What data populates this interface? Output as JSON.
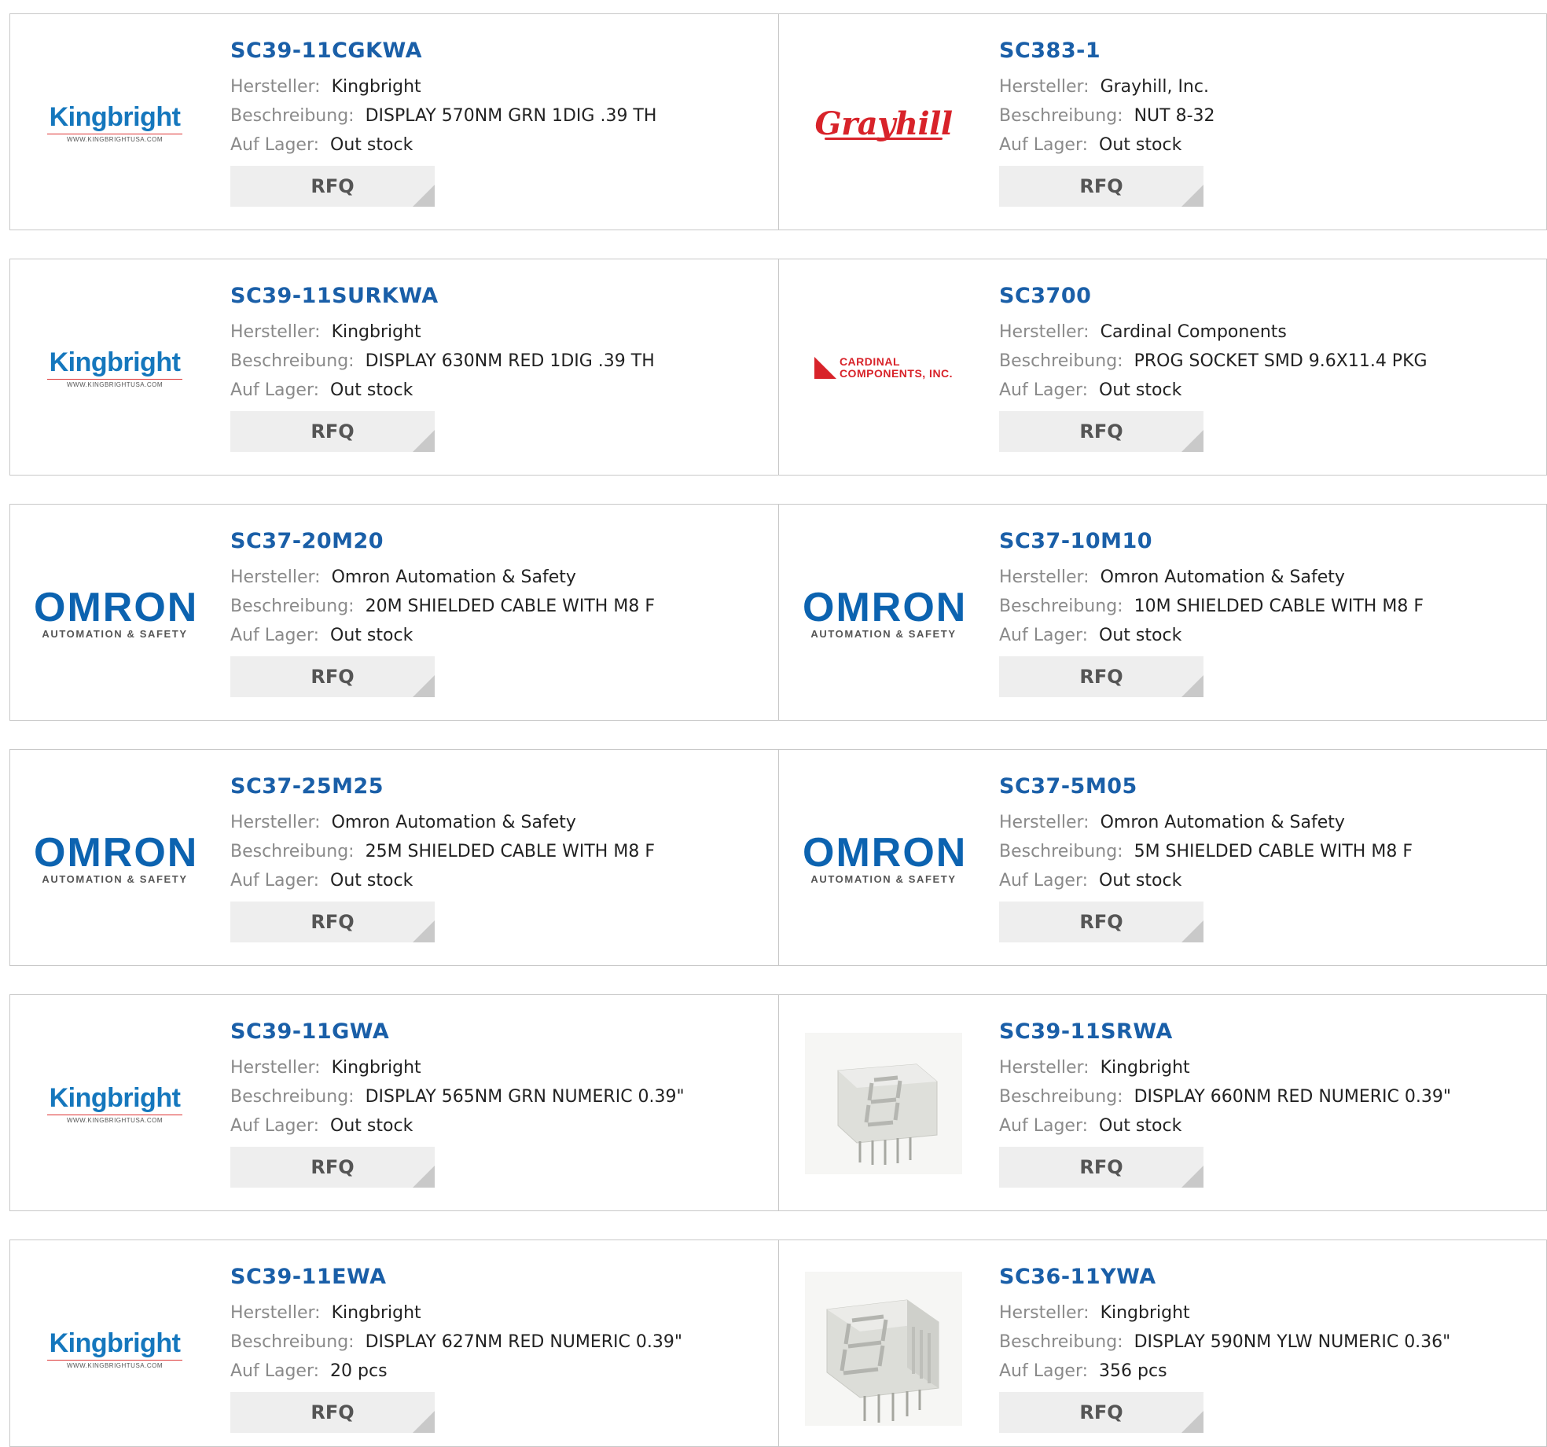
{
  "labels": {
    "manufacturer": "Hersteller:",
    "description": "Beschreibung:",
    "stock": "Auf Lager:",
    "rfq": "RFQ"
  },
  "rows": [
    [
      {
        "part": "SC39-11CGKWA",
        "manufacturer": "Kingbright",
        "description": "DISPLAY 570NM GRN 1DIG .39 TH",
        "stock": "Out stock",
        "logo": "kingbright"
      },
      {
        "part": "SC383-1",
        "manufacturer": "Grayhill, Inc.",
        "description": "NUT 8-32",
        "stock": "Out stock",
        "logo": "grayhill"
      }
    ],
    [
      {
        "part": "SC39-11SURKWA",
        "manufacturer": "Kingbright",
        "description": "DISPLAY 630NM RED 1DIG .39 TH",
        "stock": "Out stock",
        "logo": "kingbright"
      },
      {
        "part": "SC3700",
        "manufacturer": "Cardinal Components",
        "description": "PROG SOCKET SMD 9.6X11.4 PKG",
        "stock": "Out stock",
        "logo": "cardinal"
      }
    ],
    [
      {
        "part": "SC37-20M20",
        "manufacturer": "Omron Automation & Safety",
        "description": "20M SHIELDED CABLE WITH M8 F",
        "stock": "Out stock",
        "logo": "omron"
      },
      {
        "part": "SC37-10M10",
        "manufacturer": "Omron Automation & Safety",
        "description": "10M SHIELDED CABLE WITH M8 F",
        "stock": "Out stock",
        "logo": "omron"
      }
    ],
    [
      {
        "part": "SC37-25M25",
        "manufacturer": "Omron Automation & Safety",
        "description": "25M SHIELDED CABLE WITH M8 F",
        "stock": "Out stock",
        "logo": "omron"
      },
      {
        "part": "SC37-5M05",
        "manufacturer": "Omron Automation & Safety",
        "description": "5M SHIELDED CABLE WITH M8 F",
        "stock": "Out stock",
        "logo": "omron"
      }
    ],
    [
      {
        "part": "SC39-11GWA",
        "manufacturer": "Kingbright",
        "description": "DISPLAY 565NM GRN NUMERIC 0.39\"",
        "stock": "Out stock",
        "logo": "kingbright"
      },
      {
        "part": "SC39-11SRWA",
        "manufacturer": "Kingbright",
        "description": "DISPLAY 660NM RED NUMERIC 0.39\"",
        "stock": "Out stock",
        "logo": "display-photo"
      }
    ],
    [
      {
        "part": "SC39-11EWA",
        "manufacturer": "Kingbright",
        "description": "DISPLAY 627NM RED NUMERIC 0.39\"",
        "stock": "20 pcs",
        "logo": "kingbright"
      },
      {
        "part": "SC36-11YWA",
        "manufacturer": "Kingbright",
        "description": "DISPLAY 590NM YLW NUMERIC 0.36\"",
        "stock": "356 pcs",
        "logo": "display-photo-large"
      }
    ]
  ],
  "logo_text": {
    "kingbright": {
      "name": "Kingbright",
      "url": "WWW.KINGBRIGHTUSA.COM"
    },
    "omron": {
      "name": "OMRON",
      "sub": "AUTOMATION & SAFETY"
    },
    "grayhill": {
      "name": "Grayhill"
    },
    "cardinal": {
      "line1": "CARDINAL",
      "line2": "COMPONENTS, INC."
    }
  },
  "colors": {
    "part_link": "#1a5fa8",
    "label": "#8a8a8a",
    "value": "#222222",
    "rfq_bg": "#eeeeee",
    "border": "#c8c8c8"
  }
}
